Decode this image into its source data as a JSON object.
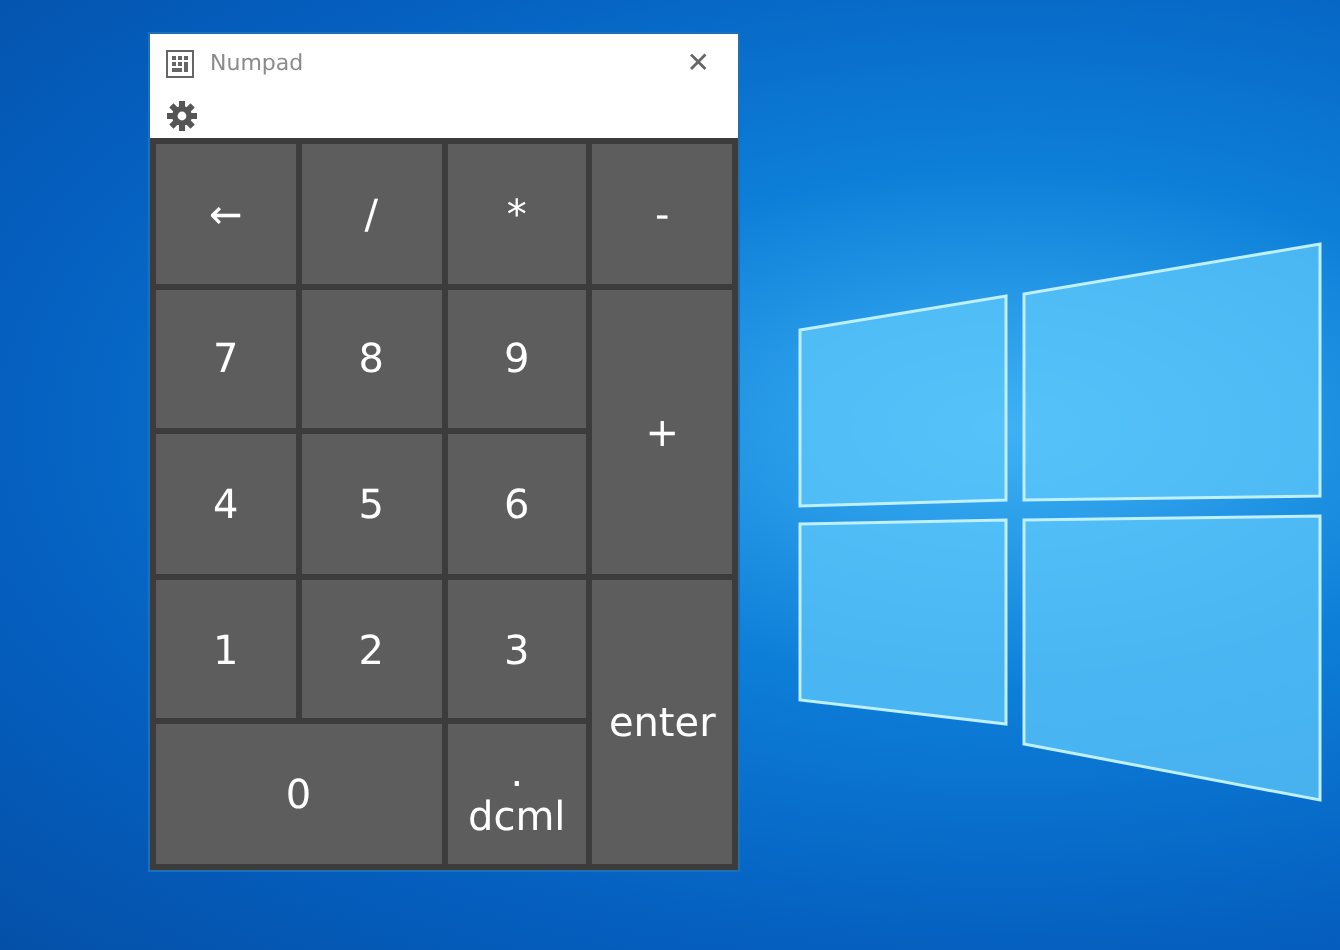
{
  "window": {
    "title": "Numpad",
    "close": "✕"
  },
  "keys": [
    {
      "kind": "single",
      "lines": [
        "←"
      ]
    },
    {
      "kind": "single",
      "lines": [
        "/"
      ]
    },
    {
      "kind": "single",
      "lines": [
        "*"
      ]
    },
    {
      "kind": "single",
      "lines": [
        "-"
      ]
    },
    {
      "kind": "single",
      "lines": [
        "7"
      ]
    },
    {
      "kind": "single",
      "lines": [
        "8"
      ]
    },
    {
      "kind": "single",
      "lines": [
        "9"
      ]
    },
    {
      "kind": "tall",
      "lines": [
        "+"
      ]
    },
    {
      "kind": "single",
      "lines": [
        "4"
      ]
    },
    {
      "kind": "single",
      "lines": [
        "5"
      ]
    },
    {
      "kind": "single",
      "lines": [
        "6"
      ]
    },
    {
      "kind": "single",
      "lines": [
        "1"
      ]
    },
    {
      "kind": "single",
      "lines": [
        "2"
      ]
    },
    {
      "kind": "single",
      "lines": [
        "3"
      ]
    },
    {
      "kind": "tall",
      "lines": [
        "enter"
      ]
    },
    {
      "kind": "wide",
      "lines": [
        "0"
      ]
    },
    {
      "kind": "single",
      "lines": [
        ".",
        "dcml"
      ]
    }
  ]
}
